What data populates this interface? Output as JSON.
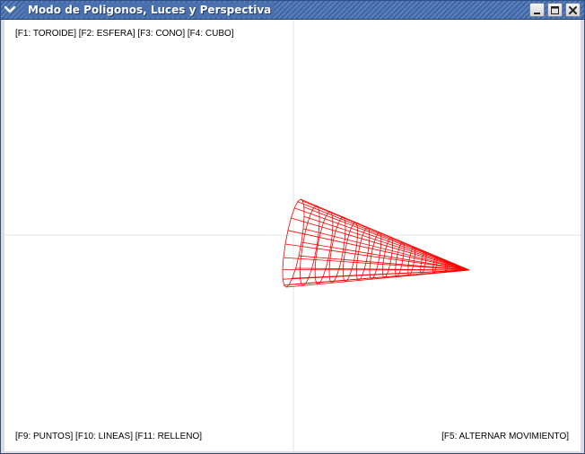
{
  "window": {
    "title": "Modo de Poligonos, Luces y Perspectiva",
    "controls": {
      "menu_icon": "chevron-down-icon",
      "minimize_icon": "minimize-icon",
      "maximize_icon": "maximize-icon",
      "close_icon": "close-icon"
    }
  },
  "overlay": {
    "shape_keys": "[F1: TOROIDE]  [F2: ESFERA]  [F3: CONO]  [F4: CUBO]",
    "render_keys": "[F9: PUNTOS]  [F10: LINEAS]  [F11: RELLENO]",
    "movement_key": "[F5: ALTERNAR MOVIMIENTO]"
  },
  "scene": {
    "background": "#ffffff",
    "axis_color": "#e6e6e6",
    "wire_color": "#ff0000",
    "object": "cono",
    "render_mode": "lineas"
  }
}
